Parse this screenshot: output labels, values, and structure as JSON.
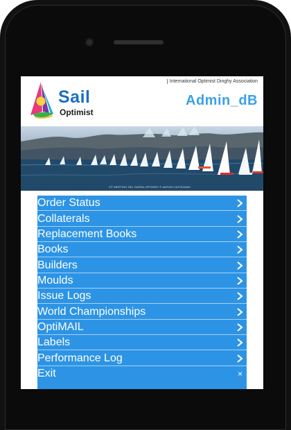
{
  "header": {
    "association": "International Optimist Dinghy Association",
    "logo_sail": "Sail",
    "logo_optimist": "Optimist",
    "admin_title": "Admin_dB"
  },
  "hero": {
    "caption": "23° MEETING DEL GARDA OPTIMIST © MATIAS CAPIZZANO"
  },
  "menu": {
    "items": [
      {
        "label": "Order Status",
        "icon": "chevron-right-icon"
      },
      {
        "label": "Collaterals",
        "icon": "chevron-right-icon"
      },
      {
        "label": "Replacement Books",
        "icon": "chevron-right-icon"
      },
      {
        "label": "Books",
        "icon": "chevron-right-icon"
      },
      {
        "label": "Builders",
        "icon": "chevron-right-icon"
      },
      {
        "label": "Moulds",
        "icon": "chevron-right-icon"
      },
      {
        "label": "Issue Logs",
        "icon": "chevron-right-icon"
      },
      {
        "label": "World Championships",
        "icon": "chevron-right-icon"
      },
      {
        "label": "OptiMAIL",
        "icon": "chevron-right-icon"
      },
      {
        "label": "Labels",
        "icon": "chevron-right-icon"
      },
      {
        "label": "Performance Log",
        "icon": "chevron-right-icon"
      },
      {
        "label": "Exit",
        "icon": "close-icon"
      }
    ]
  },
  "colors": {
    "menu_background": "#2d94e5",
    "admin_title": "#3aa0ea",
    "phone_body": "#111111"
  }
}
